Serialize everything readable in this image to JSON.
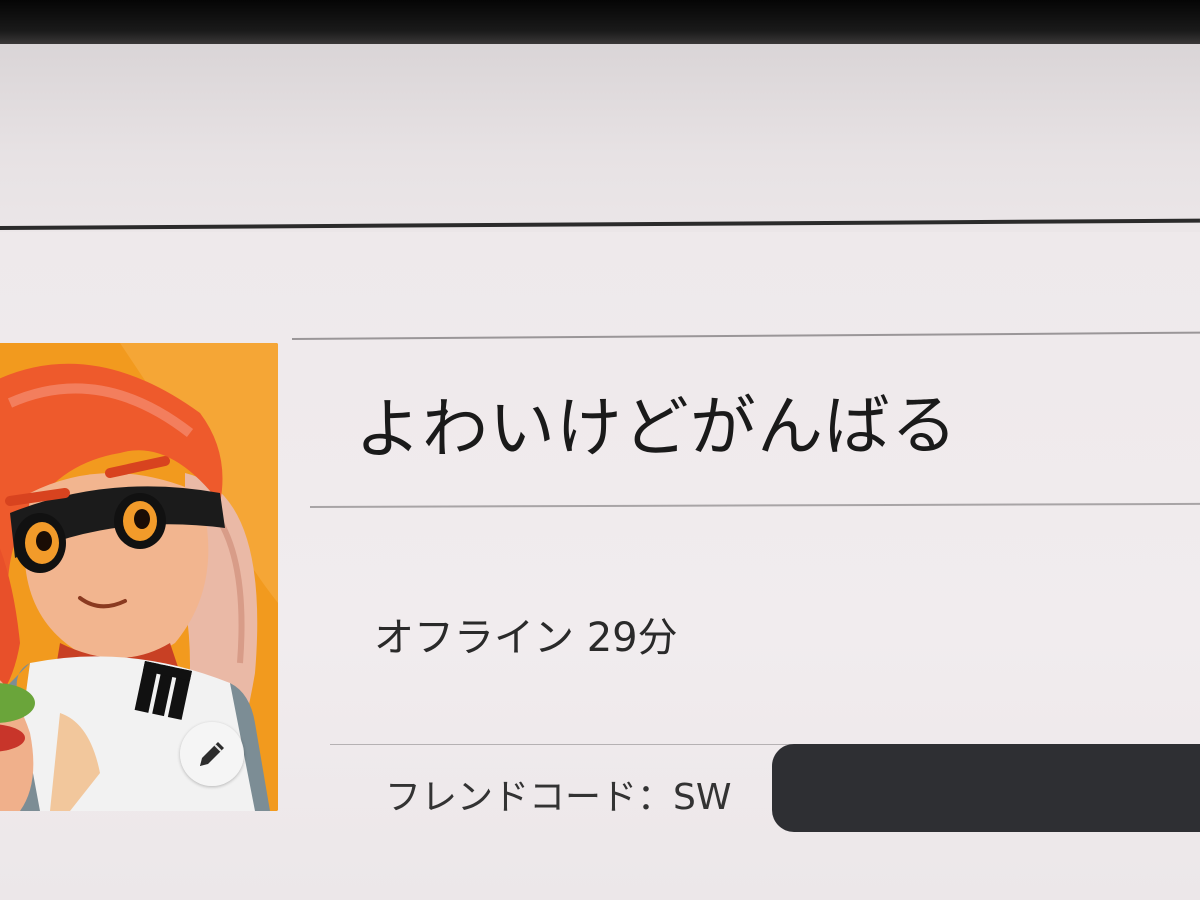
{
  "profile": {
    "nickname": "よわいけどがんばる",
    "status": "オフライン 29分",
    "friend_code_label": "フレンドコード：SW"
  },
  "icons": {
    "avatar": "inkling-girl-avatar",
    "edit": "pencil-icon"
  },
  "colors": {
    "avatar_background": "#f39a1c",
    "text": "#1a1a1a",
    "redaction": "#2e2f33"
  }
}
